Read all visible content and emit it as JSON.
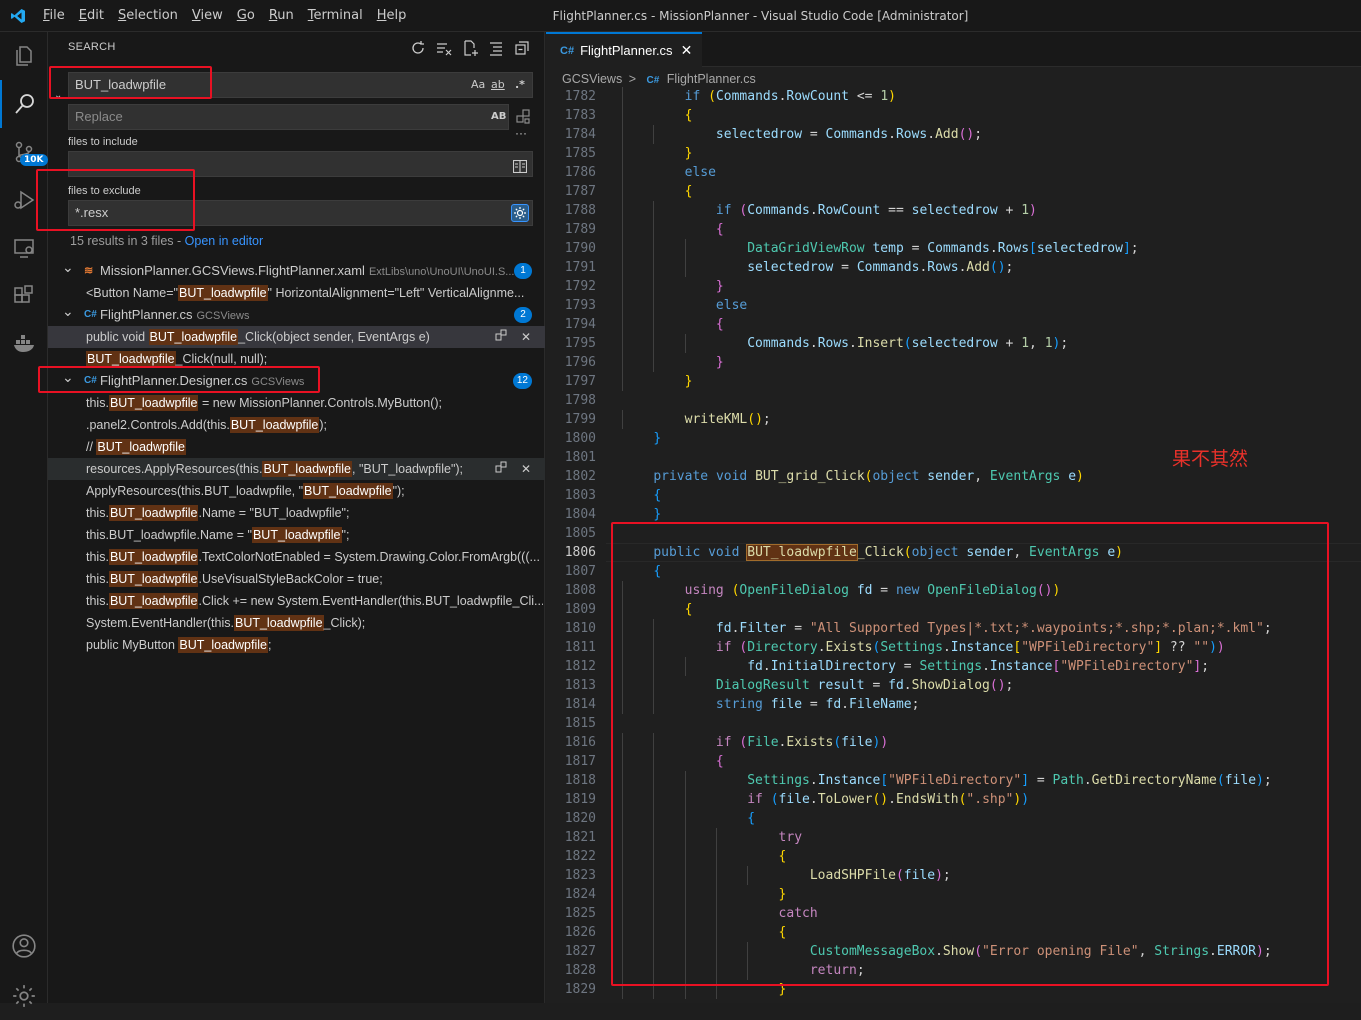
{
  "titlebar": {
    "menus": [
      "File",
      "Edit",
      "Selection",
      "View",
      "Go",
      "Run",
      "Terminal",
      "Help"
    ],
    "menu_underlines": [
      "F",
      "E",
      "S",
      "V",
      "G",
      "R",
      "T",
      "H"
    ],
    "title": "FlightPlanner.cs - MissionPlanner - Visual Studio Code [Administrator]"
  },
  "activity": {
    "scm_badge": "10K"
  },
  "search": {
    "panel_title": "SEARCH",
    "query": "BUT_loadwpfile",
    "opt_case": "Aa",
    "opt_word": "ab",
    "opt_regex": ".*",
    "replace_placeholder": "Replace",
    "replace_opt": "AB",
    "more": "···",
    "include_label": "files to include",
    "include_value": "",
    "exclude_label": "files to exclude",
    "exclude_value": "*.resx",
    "summary_text": "15 results in 3 files - ",
    "summary_link": "Open in editor"
  },
  "results": {
    "files": [
      {
        "name": "MissionPlanner.GCSViews.FlightPlanner.xaml",
        "path": "ExtLibs\\uno\\UnoUI\\UnoUI.S...",
        "count": "1",
        "icon": "xaml"
      },
      {
        "name": "FlightPlanner.cs",
        "path": "GCSViews",
        "count": "2",
        "icon": "cs"
      },
      {
        "name": "FlightPlanner.Designer.cs",
        "path": "GCSViews",
        "count": "12",
        "icon": "cs"
      }
    ],
    "matches": [
      {
        "pre": "<Button Name=\"",
        "hit": "BUT_loadwpfile",
        "post": "\" HorizontalAlignment=\"Left\" VerticalAlignme..."
      },
      {
        "pre": "public void ",
        "hit": "BUT_loadwpfile",
        "post": "_Click(object sender, EventArgs e)"
      },
      {
        "pre": "",
        "hit": "BUT_loadwpfile",
        "post": "_Click(null, null);"
      },
      {
        "pre": "this.",
        "hit": "BUT_loadwpfile",
        "post": " = new MissionPlanner.Controls.MyButton();"
      },
      {
        "pre": ".panel2.Controls.Add(this.",
        "hit": "BUT_loadwpfile",
        "post": ");"
      },
      {
        "pre": "// ",
        "hit": "BUT_loadwpfile",
        "post": ""
      },
      {
        "pre": "resources.ApplyResources(this.",
        "hit": "BUT_loadwpfile",
        "post": ", \"BUT_loadwpfile\");"
      },
      {
        "pre": "ApplyResources(this.BUT_loadwpfile, \"",
        "hit": "BUT_loadwpfile",
        "post": "\");"
      },
      {
        "pre": "this.",
        "hit": "BUT_loadwpfile",
        "post": ".Name = \"BUT_loadwpfile\";"
      },
      {
        "pre": "this.BUT_loadwpfile.Name = \"",
        "hit": "BUT_loadwpfile",
        "post": "\";"
      },
      {
        "pre": "this.",
        "hit": "BUT_loadwpfile",
        "post": ".TextColorNotEnabled = System.Drawing.Color.FromArgb(((..."
      },
      {
        "pre": "this.",
        "hit": "BUT_loadwpfile",
        "post": ".UseVisualStyleBackColor = true;"
      },
      {
        "pre": "this.",
        "hit": "BUT_loadwpfile",
        "post": ".Click += new System.EventHandler(this.BUT_loadwpfile_Cli..."
      },
      {
        "pre": "System.EventHandler(this.",
        "hit": "BUT_loadwpfile",
        "post": "_Click);"
      },
      {
        "pre": "public MyButton ",
        "hit": "BUT_loadwpfile",
        "post": ";"
      }
    ]
  },
  "editor": {
    "tab_label": "FlightPlanner.cs",
    "tab_icon": "C#",
    "breadcrumb": [
      "GCSViews",
      "FlightPlanner.cs"
    ],
    "breadcrumb_sep": ">",
    "line_numbers": [
      "1782",
      "1783",
      "1784",
      "1785",
      "1786",
      "1787",
      "1788",
      "1789",
      "1790",
      "1791",
      "1792",
      "1793",
      "1794",
      "1795",
      "1796",
      "1797",
      "1798",
      "1799",
      "1800",
      "1801",
      "1802",
      "1803",
      "1804",
      "1805",
      "1806",
      "1807",
      "1808",
      "1809",
      "1810",
      "1811",
      "1812",
      "1813",
      "1814",
      "1815",
      "1816",
      "1817",
      "1818",
      "1819",
      "1820",
      "1821",
      "1822",
      "1823",
      "1824",
      "1825",
      "1826",
      "1827",
      "1828",
      "1829"
    ],
    "current_line": "1806"
  },
  "annotation": {
    "text": "果不其然",
    "color": "#e8312a"
  },
  "colors": {
    "accent": "#0078d4",
    "highlight_box": "#e81123"
  }
}
